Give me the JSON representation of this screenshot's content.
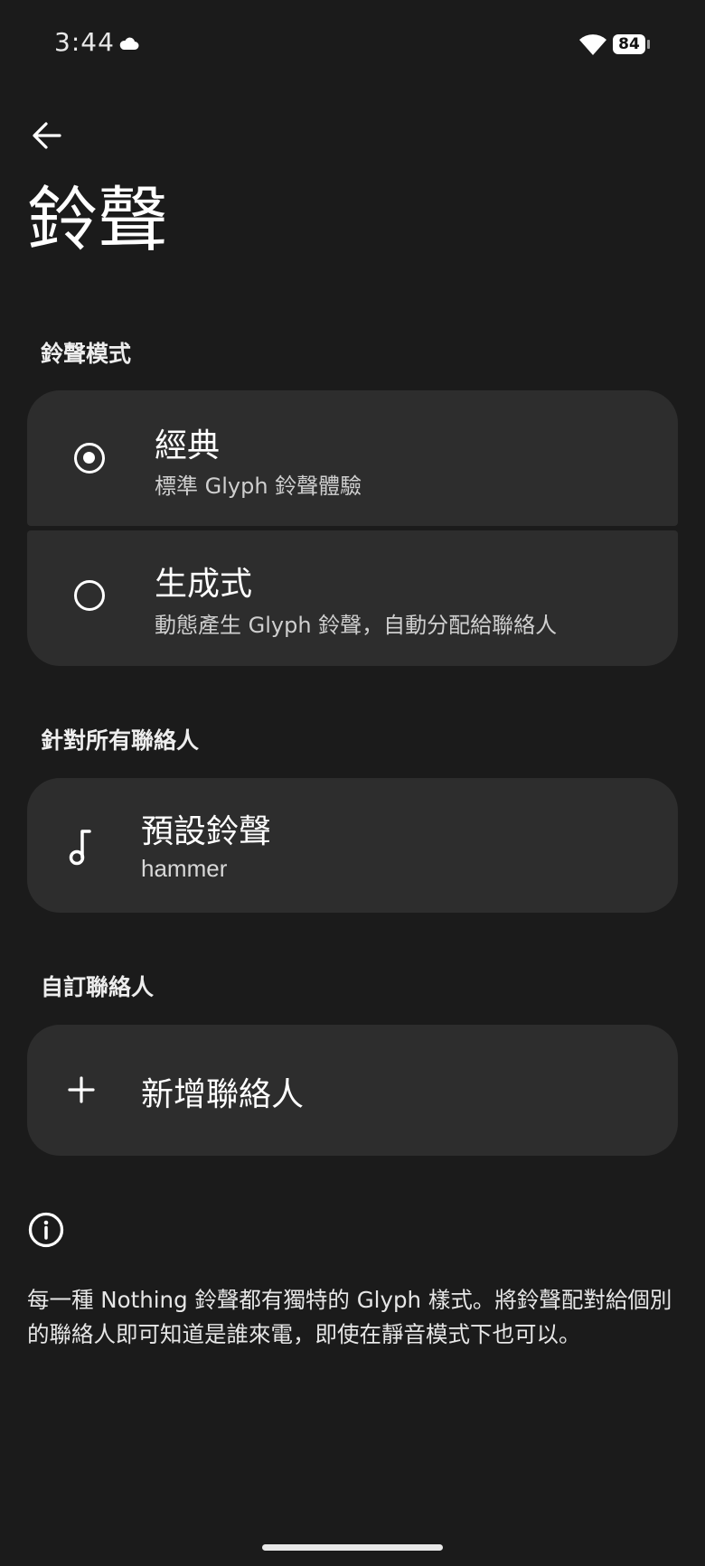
{
  "status_bar": {
    "time": "3:44",
    "battery_level": "84",
    "icons": [
      "cloud-icon",
      "wifi-icon",
      "battery-icon"
    ]
  },
  "header": {
    "back_icon": "arrow-left-icon",
    "title": "鈴聲"
  },
  "ringtone_mode": {
    "header": "鈴聲模式",
    "options": [
      {
        "title": "經典",
        "subtitle": "標準 Glyph 鈴聲體驗",
        "selected": true
      },
      {
        "title": "生成式",
        "subtitle": "動態產生 Glyph 鈴聲，自動分配給聯絡人",
        "selected": false
      }
    ]
  },
  "all_contacts": {
    "header": "針對所有聯絡人",
    "default_ringtone": {
      "icon": "music-note-icon",
      "title": "預設鈴聲",
      "value": "hammer"
    }
  },
  "custom_contacts": {
    "header": "自訂聯絡人",
    "add_contact": {
      "icon": "plus-icon",
      "label": "新增聯絡人"
    }
  },
  "info": {
    "icon": "info-icon",
    "text": "每一種 Nothing 鈴聲都有獨特的 Glyph 樣式。將鈴聲配對給個別的聯絡人即可知道是誰來電，即使在靜音模式下也可以。"
  },
  "colors": {
    "background": "#1b1b1b",
    "card": "#2d2d2d",
    "text": "#ffffff",
    "subtext": "#cfcfcf"
  }
}
